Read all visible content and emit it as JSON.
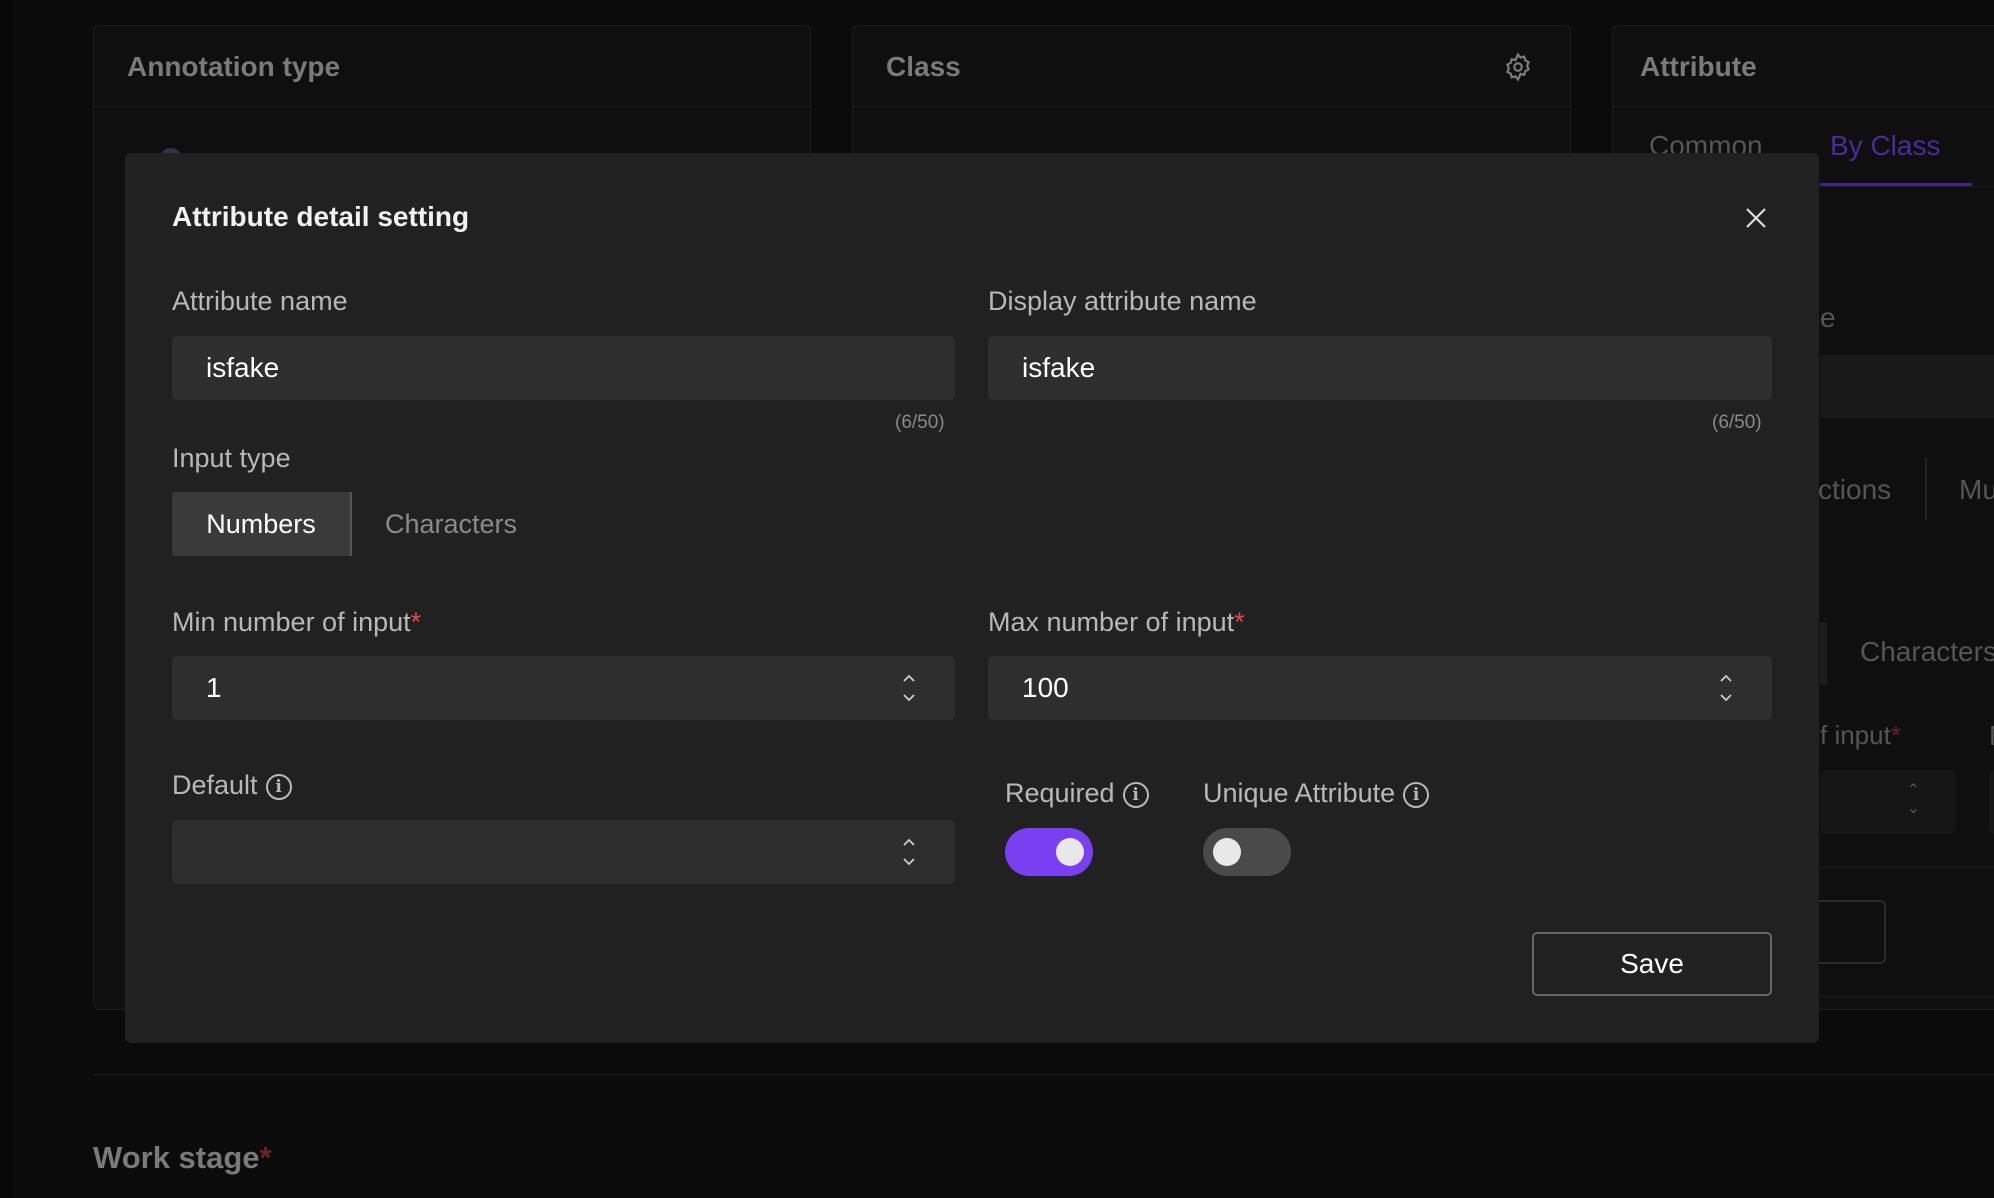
{
  "background": {
    "panels": [
      {
        "title": "Annotation type"
      },
      {
        "title": "Class",
        "icon": "gear-icon"
      },
      {
        "title": "Attribute"
      }
    ],
    "attribute_tabs": [
      "Common",
      "By Class"
    ],
    "active_tab": "By Class",
    "fragments": {
      "name_label_tail": "e",
      "tab_tail": "ctions",
      "tab_next": "Mu",
      "characters": "Characters",
      "input_label_tail": "f input",
      "next_label": "N"
    },
    "work_stage": "Work stage",
    "required_mark": "*"
  },
  "modal": {
    "title": "Attribute detail setting",
    "attribute_name": {
      "label": "Attribute name",
      "value": "isfake",
      "counter": "(6/50)"
    },
    "display_attribute_name": {
      "label": "Display attribute name",
      "value": "isfake",
      "counter": "(6/50)"
    },
    "input_type": {
      "label": "Input type",
      "options": [
        "Numbers",
        "Characters"
      ],
      "selected": "Numbers"
    },
    "min": {
      "label": "Min number of input",
      "value": "1"
    },
    "max": {
      "label": "Max number of input",
      "value": "100"
    },
    "default": {
      "label": "Default",
      "value": ""
    },
    "required": {
      "label": "Required",
      "on": true
    },
    "unique": {
      "label": "Unique Attribute",
      "on": false
    },
    "save_label": "Save",
    "required_mark": "*"
  },
  "colors": {
    "accent": "#7b3ff2",
    "required": "#e5484d"
  }
}
